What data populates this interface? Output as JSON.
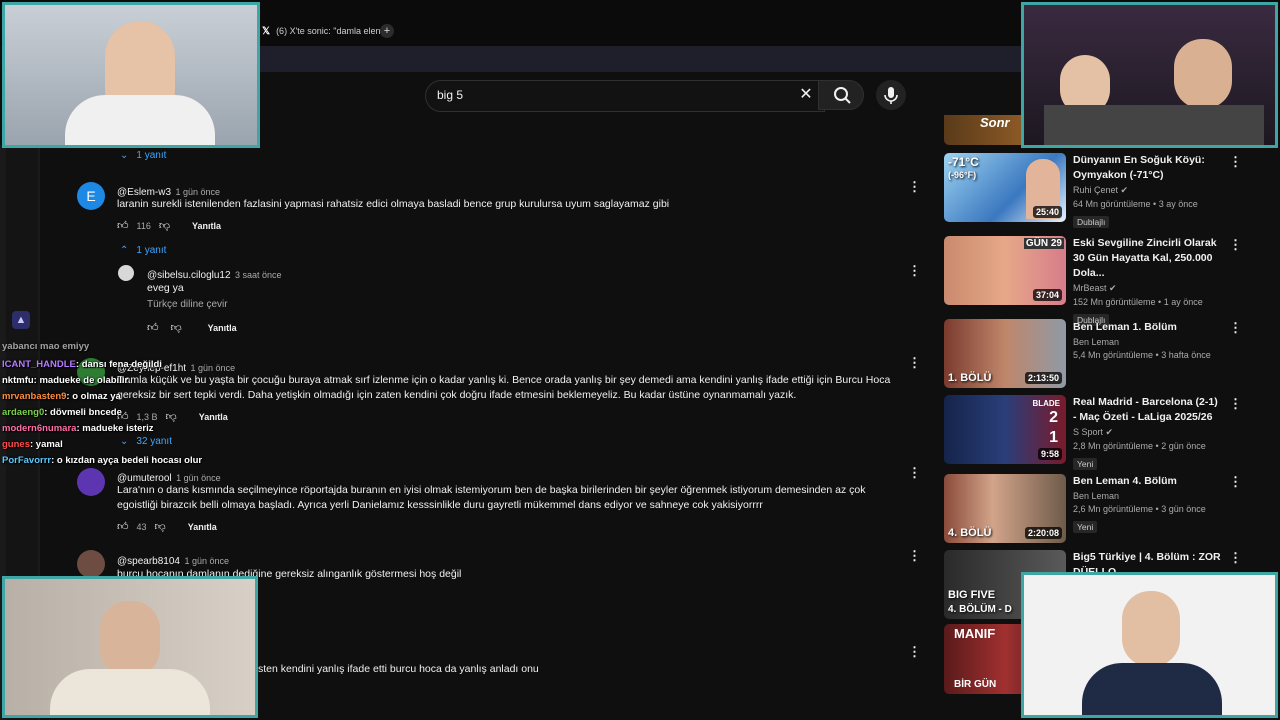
{
  "browser": {
    "tab_title": "(6) X'te sonic: \"damla elen",
    "new_tab": "+"
  },
  "search": {
    "query": "big 5",
    "clear_icon": "close-icon",
    "search_icon": "search-icon",
    "mic_icon": "mic-icon"
  },
  "comments": {
    "reply_toggle_top": "1 yanıt",
    "c1": {
      "avatar_letter": "E",
      "handle": "@Eslem-w3",
      "time": "1 gün önce",
      "text": "laranin surekli istenilenden fazlasini yapmasi rahatsiz edici olmaya basladi bence grup kurulursa uyum saglayamaz gibi",
      "likes": "116",
      "reply_label": "Yanıtla",
      "replies_toggle": "1 yanıt"
    },
    "r1": {
      "handle": "@sibelsu.ciloglu12",
      "time": "3 saat önce",
      "text": "eveg ya",
      "translate": "Türkçe diline çevir",
      "reply_label": "Yanıtla"
    },
    "c2": {
      "handle": "@Zeynep-ef1ht",
      "time": "1 gün önce",
      "text": "Damla küçük ve bu yaşta bir çocuğu buraya atmak sırf izlenme için o kadar yanlış ki. Bence orada yanlış bir şey demedi ama kendini yanlış ifade ettiği için Burcu Hoca gereksiz bir sert tepki verdi. Daha yetişkin olmadığı için zaten kendini çok doğru ifade etmesini beklemeyeliz. Bu kadar üstüne oynanmamalı yazık.",
      "likes": "1,3 B",
      "reply_label": "Yanıtla",
      "replies_toggle": "32 yanıt"
    },
    "c3": {
      "handle": "@umuterool",
      "time": "1 gün önce",
      "text": "Lara'nın o dans kısmında seçilmeyince röportajda buranın en iyisi olmak istemiyorum ben de başka birilerinden bir şeyler öğrenmek istiyorum demesinden az çok egoistliği birazcık belli olmaya başladı. Ayrıca yerli Danielamız kesssinlikle duru gayretli mükemmel dans ediyor ve sahneye cok yakisiyorrrr",
      "likes": "43",
      "reply_label": "Yanıtla"
    },
    "c4": {
      "handle": "@spearb8104",
      "time": "1 gün önce",
      "text": "burcu hocanın damlanın dediğine gereksiz alınganlık göstermesi hoş değil"
    },
    "c5": {
      "text": "sten kendini yanlış ifade etti burcu hoca da yanlış anladı onu"
    }
  },
  "chat": [
    {
      "user": "yabancı",
      "msg": "mao emiyy",
      "color": "#ffffff"
    },
    {
      "user": "ICANT_HANDLE",
      "msg": ": dansı fena değildi",
      "color": "#b57bff"
    },
    {
      "user": "nktmfu",
      "msg": ": madueke de olabilir",
      "color": "#ffffff"
    },
    {
      "user": "mrvanbasten9",
      "msg": ": o olmaz ya",
      "color": "#ff8c3a"
    },
    {
      "user": "ardaeng0",
      "msg": ": dövmeli bncede",
      "color": "#7bd14b"
    },
    {
      "user": "modern6numara",
      "msg": ": madueke isteriz",
      "color": "#ff6fa8"
    },
    {
      "user": "gunes",
      "msg": ": yamal",
      "color": "#ff4a4a"
    },
    {
      "user": "PorFavorrr",
      "msg": ": o kızdan ayça bedeli hocası olur",
      "color": "#5cc9ff"
    }
  ],
  "sidebar_videos": [
    {
      "title": "Dünyanın En Soğuk Köyü: Oymyakon (-71°C)",
      "channel": "Ruhi Çenet",
      "verified": true,
      "meta": "64 Mn görüntüleme • 3 ay önce",
      "badge": "Dublajlı",
      "duration": "25:40"
    },
    {
      "title": "Eski Sevgiline Zincirli Olarak 30 Gün Hayatta Kal, 250.000 Dola...",
      "channel": "MrBeast",
      "verified": true,
      "meta": "152 Mn görüntüleme • 1 ay önce",
      "badge": "Dublajlı",
      "duration": "37:04"
    },
    {
      "title": "Ben Leman 1. Bölüm",
      "channel": "Ben Leman",
      "verified": false,
      "meta": "5,4 Mn görüntüleme • 3 hafta önce",
      "badge": "",
      "duration": "2:13:50"
    },
    {
      "title": "Real Madrid - Barcelona (2-1) - Maç Özeti - LaLiga 2025/26",
      "channel": "S Sport",
      "verified": true,
      "meta": "2,8 Mn görüntüleme • 2 gün önce",
      "badge": "Yeni",
      "duration": "9:58"
    },
    {
      "title": "Ben Leman 4. Bölüm",
      "channel": "Ben Leman",
      "verified": false,
      "meta": "2,6 Mn görüntüleme • 3 gün önce",
      "badge": "Yeni",
      "duration": "2:20:08"
    },
    {
      "title": "Big5 Türkiye | 4. Bölüm : ZOR DÜELLO",
      "channel": "",
      "verified": false,
      "meta": "",
      "badge": "",
      "duration": ""
    }
  ],
  "thumb_overlays": {
    "t0": "Sonr",
    "t1_a": "-71°C",
    "t1_b": "(-96°F)",
    "t2": "GÜN 29",
    "t3": "1. BÖLÜ",
    "t4_brand": "BLADE",
    "t4_s1": "2",
    "t4_s2": "1",
    "t5": "4. BÖLÜ",
    "t6": "BIG FIVE",
    "t6b": "4. BÖLÜM - D",
    "t7": "MANIF",
    "t7b": "BİR GÜN"
  },
  "colors": {
    "accent": "#3ea6ff",
    "background": "#0f0f0f",
    "cam_border": "#3fa6a6"
  }
}
